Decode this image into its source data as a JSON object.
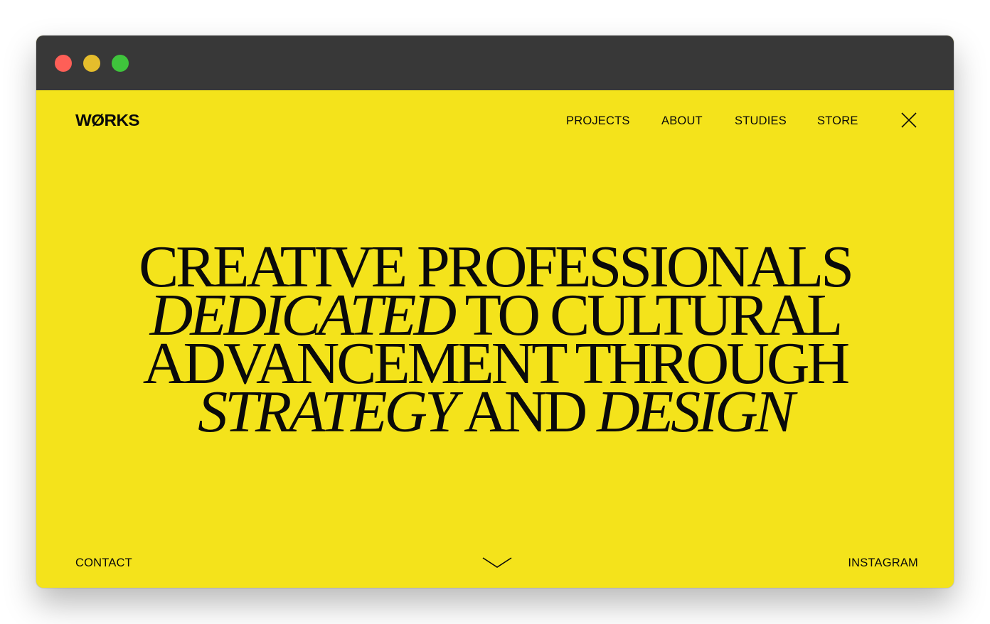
{
  "window": {
    "controls": [
      "close",
      "minimize",
      "maximize"
    ]
  },
  "header": {
    "logo": "WØRKS",
    "nav": [
      {
        "label": "PROJECTS"
      },
      {
        "label": "ABOUT"
      },
      {
        "label": "STUDIES"
      },
      {
        "label": "STORE"
      }
    ],
    "close_icon": "close-icon"
  },
  "hero": {
    "line1": "CREATIVE PROFESSIONALS",
    "line2_italic": "DEDICATED",
    "line2_rest": " TO CULTURAL",
    "line3": "ADVANCEMENT THROUGH",
    "line4_italic_a": "STRATEGY",
    "line4_mid": " AND ",
    "line4_italic_b": "DESIGN"
  },
  "footer": {
    "left_link": "CONTACT",
    "right_link": "INSTAGRAM",
    "scroll_icon": "chevron-down-icon"
  },
  "colors": {
    "background": "#f4e31b",
    "text": "#0a0a0a",
    "titlebar": "#383838"
  }
}
